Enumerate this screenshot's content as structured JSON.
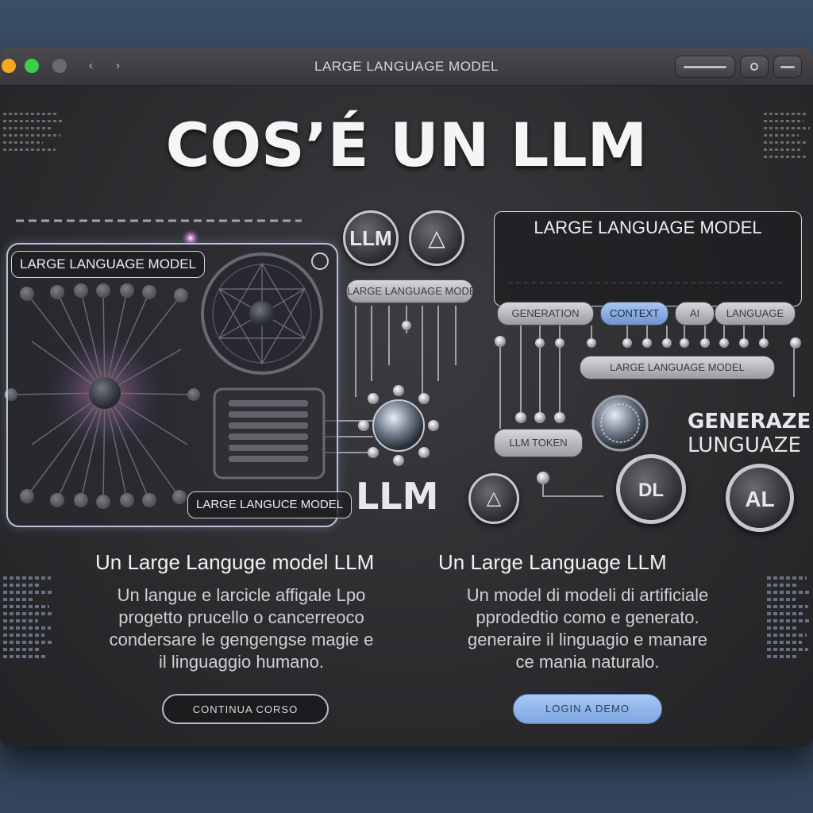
{
  "window": {
    "title": "LARGE LANGUAGE MODEL",
    "nav": [
      "‹",
      "›"
    ]
  },
  "hero": {
    "title": "COS’É UN LLM"
  },
  "left_panel": {
    "header_label": "LARGE LANGUAGE MODEL",
    "footer_label": "LARGE LANGUCE MODEL"
  },
  "center": {
    "badge_llm": "LLM",
    "badge_triangle": "△",
    "pill_top": "LARGE LANGUAGE MODEL",
    "big_label": "LLM"
  },
  "right_panel": {
    "header_label": "LARGE LANGUAGE MODEL",
    "pills": [
      "GENERATION",
      "CONTEXT",
      "AI",
      "LANGUAGE"
    ],
    "wide_pill": "LARGE LANGUAGE MODEL",
    "lower_pill": "LLM TOKEN",
    "side_title_line1": "GENERAZE",
    "side_title_line2": "LUNGUAZE",
    "circle_buttons": [
      "△",
      "DL",
      "AL"
    ]
  },
  "sections": [
    {
      "title": "Un Large Languge model  LLM",
      "body": [
        "Un langue e larcicle affigale Lpo",
        "progetto prucello o cancerreoco",
        "condersare le gengengse magie e",
        "il linguaggio humano."
      ],
      "button": "CONTINUA CORSO"
    },
    {
      "title": "Un Large Language LLM",
      "body": [
        "Un model di modeli di artificiale",
        "pprodedtio como e generato.",
        "generaire il linguagio e manare",
        "ce mania naturalo."
      ],
      "button": "LOGIN A DEMO"
    }
  ],
  "colors": {
    "accent_blue": "#8fb4ec",
    "panel_border": "#b8c4d6",
    "glow_core": "#ff9ad0"
  }
}
